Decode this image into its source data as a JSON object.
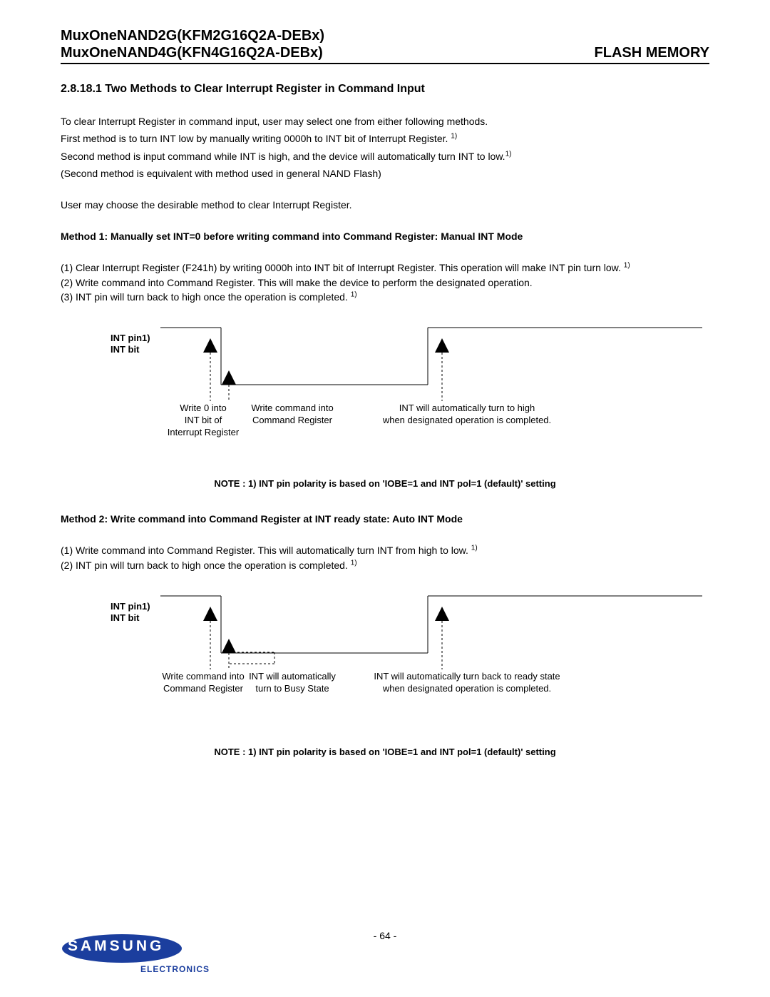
{
  "header": {
    "left1": "MuxOneNAND2G(KFM2G16Q2A-DEBx)",
    "left2": "MuxOneNAND4G(KFN4G16Q2A-DEBx)",
    "right": "FLASH MEMORY"
  },
  "section_title": "2.8.18.1 Two Methods to Clear Interrupt Register in Command Input",
  "intro": {
    "p1": "To clear Interrupt Register in command input, user may select one from either following methods.",
    "p2a": "First method is to turn INT low by manually writing 0000h to INT bit of Interrupt Register. ",
    "p3a": "Second method is input command while INT is high, and the device will automatically turn INT to low.",
    "p4": "(Second method is equivalent with method used in general NAND Flash)",
    "p5": "User may choose the desirable method to clear Interrupt Register."
  },
  "method1": {
    "title": "Method 1: Manually set INT=0  before writing command into Command Register: Manual INT Mode",
    "s1a": "(1) Clear Interrupt Register (F241h) by writing 0000h into INT bit of Interrupt Register. This operation will make INT pin turn low. ",
    "s2": "(2) Write command into Command Register. This will make the device to perform the designated operation.",
    "s3a": "(3) INT pin will turn back to high once the operation is completed. ",
    "diagram": {
      "axis1": "INT pin1)",
      "axis2": "INT bit",
      "c1l1": "Write 0 into",
      "c1l2": "INT bit of",
      "c1l3": "Interrupt Register",
      "c2l1": "Write command into",
      "c2l2": "Command Register",
      "c3l1": "INT will automatically turn to high",
      "c3l2": "when designated operation is completed."
    },
    "note": "NOTE : 1) INT pin polarity is based on 'IOBE=1 and INT pol=1 (default)' setting"
  },
  "method2": {
    "title": "Method 2: Write command into Command Register at INT ready state: Auto INT Mode",
    "s1a": "(1) Write command into Command Register. This will automatically turn INT from high to low. ",
    "s2a": "(2) INT pin will turn back to high once the operation is completed. ",
    "diagram": {
      "axis1": "INT pin1)",
      "axis2": "INT bit",
      "c1l1": "Write command into",
      "c1l2": "Command Register",
      "c2l1": "INT will automatically",
      "c2l2": "turn to Busy State",
      "c3l1": "INT will automatically turn back to ready state",
      "c3l2": "when designated operation is completed."
    },
    "note": "NOTE : 1) INT pin polarity is based on 'IOBE=1 and INT pol=1 (default)' setting"
  },
  "footer": {
    "page": "- 64 -",
    "logo": "SAMSUNG",
    "sub": "ELECTRONICS"
  }
}
